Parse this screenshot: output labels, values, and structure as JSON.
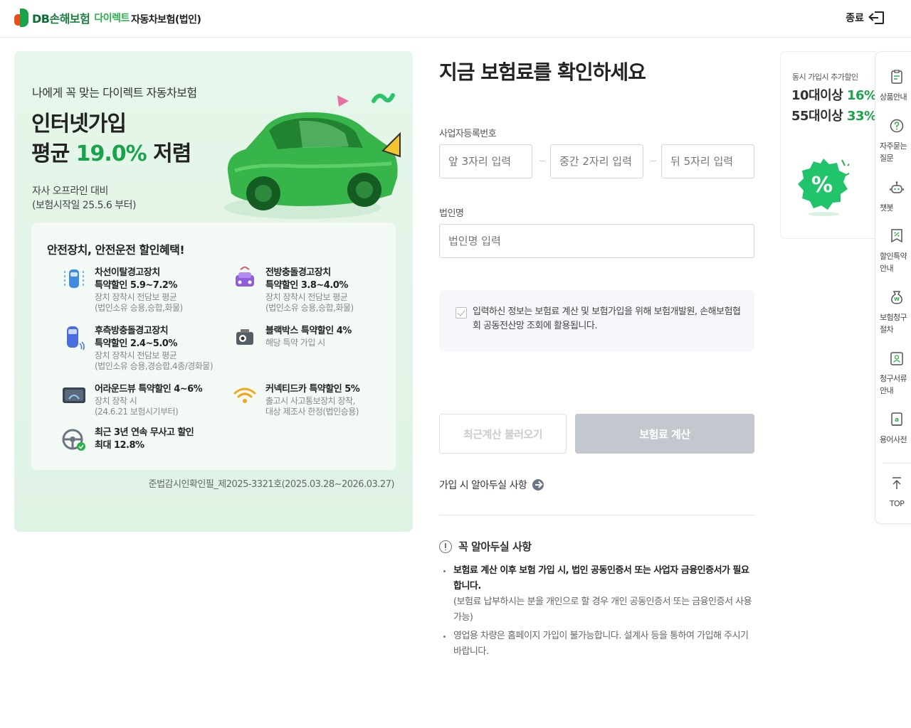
{
  "header": {
    "logo_db": "DB",
    "logo_company": "손해보험",
    "logo_direct": "다이렉트",
    "page_title": "자동차보험(법인)",
    "exit_label": "종료"
  },
  "banner": {
    "subtitle": "나에게 꼭 맞는 다이렉트 자동차보험",
    "headline_line1": "인터넷가입",
    "headline_prefix": "평균 ",
    "headline_highlight": "19.0%",
    "headline_suffix": " 저렴",
    "note_line1": "자사 오프라인 대비",
    "note_line2": "(보험시작일 25.5.6 부터)",
    "benefits_title": "안전장치, 안전운전 할인혜택!",
    "benefits": [
      {
        "icon": "lane-departure-icon",
        "title": "차선이탈경고장치\n특약할인 5.9~7.2%",
        "desc": "장치 장착시 전담보 평균\n(법인소유 승용,승합,화물)"
      },
      {
        "icon": "forward-collision-icon",
        "title": "전방충돌경고장치\n특약할인 3.8~4.0%",
        "desc": "장치 장착시 전담보 평균\n(법인소유 승용,승합,화물)"
      },
      {
        "icon": "rear-collision-icon",
        "title": "후측방충돌경고장치\n특약할인 2.4~5.0%",
        "desc": "장치 장착시 전담보 평균\n(법인소유 승용,경승합,4종/경화물)"
      },
      {
        "icon": "blackbox-icon",
        "title": "블랙박스 특약할인 4%",
        "desc": "해당 특약 가입 시"
      },
      {
        "icon": "around-view-icon",
        "title": "어라운드뷰 특약할인 4~6%",
        "desc": "장치 장착 시\n(24.6.21 보험시기부터)"
      },
      {
        "icon": "connected-car-icon",
        "title": "커넥티드카 특약할인 5%",
        "desc": "출고시 사고통보장치 장착,\n대상 제조사 한정(법인승용)"
      },
      {
        "icon": "steering-wheel-icon",
        "title": "최근 3년 연속 무사고 할인\n최대 12.8%",
        "desc": ""
      }
    ],
    "permit": "준법감시인확인필_제2025-3321호(2025.03.28~2026.03.27)"
  },
  "form": {
    "title": "지금 보험료를 확인하세요",
    "biz_label": "사업자등록번호",
    "biz_first_placeholder": "앞 3자리 입력",
    "biz_mid_placeholder": "중간 2자리 입력",
    "biz_last_placeholder": "뒤 5자리 입력",
    "corp_label": "법인명",
    "corp_placeholder": "법인명 입력",
    "consent_text": "입력하신 정보는 보험료 계산 및 보험가입을 위해 보험개발원, 손해보험협회 공동전산망 조회에 활용됩니다.",
    "recent_button": "최근계산 불러오기",
    "calc_button": "보험료 계산",
    "know_link": "가입 시 알아두실 사항",
    "must_title": "꼭 알아두실 사항",
    "must_item1_strong": "보험료 계산 이후 보험 가입 시, 법인 공동인증서 또는 사업자 금융인증서가 필요합니다.",
    "must_item1_sub": "(보험료 납부하시는 분을 개인으로 할 경우 개인 공동인증서 또는 금융인증서 사용 가능)",
    "must_item2": "영업용 차량은 홈페이지 가입이 불가능합니다. 설계사 등을 통하여 가입해 주시기 바랍니다."
  },
  "promo": {
    "subtitle": "동시 가입시 추가할인",
    "line1_prefix": "10대이상 ",
    "line1_value": "16%",
    "line2_prefix": "55대이상 ",
    "line2_value": "33%"
  },
  "sidemenu": {
    "items": [
      {
        "icon": "product-guide-icon",
        "label": "상품안내"
      },
      {
        "icon": "faq-icon",
        "label": "자주묻는\n질문"
      },
      {
        "icon": "chatbot-icon",
        "label": "챗봇"
      },
      {
        "icon": "discount-icon",
        "label": "할인특약\n안내"
      },
      {
        "icon": "claim-process-icon",
        "label": "보험청구\n절차"
      },
      {
        "icon": "claim-docs-icon",
        "label": "청구서류\n안내"
      },
      {
        "icon": "glossary-icon",
        "label": "용어사전"
      }
    ],
    "top_label": "TOP"
  },
  "colors": {
    "brand_green": "#1aa34a",
    "banner_bg": "#e6f6ea",
    "disabled_button": "#c3c8cf"
  }
}
